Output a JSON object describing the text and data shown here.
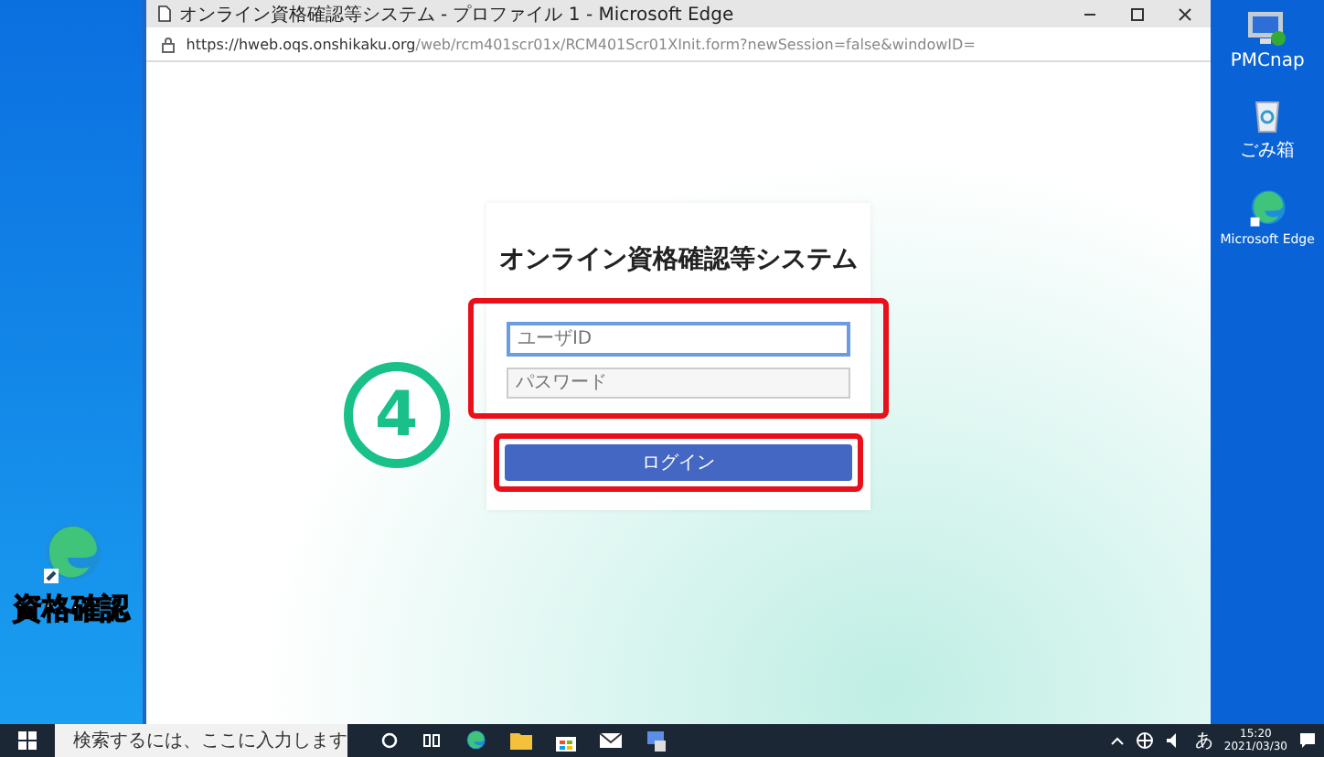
{
  "browser": {
    "title": "オンライン資格確認等システム - プロファイル 1 - Microsoft Edge",
    "url_host": "https://hweb.oqs.onshikaku.org",
    "url_path": "/web/rcm401scr01x/RCM401Scr01XInit.form?newSession=false&windowID="
  },
  "login": {
    "heading": "オンライン資格確認等システム",
    "fields": [
      {
        "placeholder": "ユーザID",
        "focused": true
      },
      {
        "placeholder": "パスワード",
        "focused": false
      }
    ],
    "button": "ログイン"
  },
  "annotation": {
    "step": "4"
  },
  "desktop_left": [
    {
      "label": "資格確認",
      "kind": "edge"
    }
  ],
  "desktop_right": [
    {
      "label": "PMCnap",
      "kind": "monitor"
    },
    {
      "label": "ごみ箱",
      "kind": "bin"
    },
    {
      "label": "Microsoft Edge",
      "kind": "edge"
    }
  ],
  "taskbar": {
    "search_placeholder": "検索するには、ここに入力します",
    "ime": "あ",
    "time": "15:20",
    "date": "2021/03/30"
  }
}
